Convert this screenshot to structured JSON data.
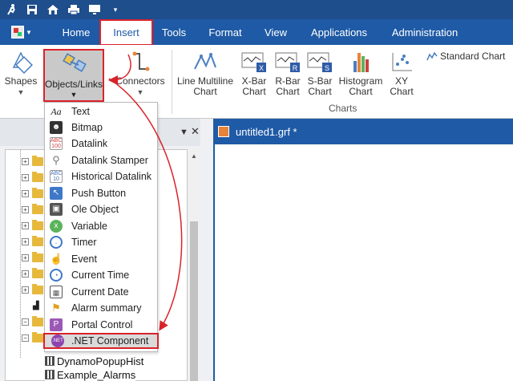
{
  "quick_access": {
    "icons": [
      "run-icon",
      "save-icon",
      "home-save-icon",
      "print-icon",
      "monitor-icon",
      "dropdown-icon"
    ]
  },
  "tabs": [
    {
      "label": "Home"
    },
    {
      "label": "Insert",
      "active": true
    },
    {
      "label": "Tools"
    },
    {
      "label": "Format"
    },
    {
      "label": "View"
    },
    {
      "label": "Applications"
    },
    {
      "label": "Administration"
    }
  ],
  "ribbon": {
    "shapes": "Shapes",
    "objects_links": "Objects/Links",
    "connectors": "Connectors",
    "line_multiline_chart": [
      "Line Multiline",
      "Chart"
    ],
    "xbar_chart": [
      "X-Bar",
      "Chart"
    ],
    "rbar_chart": [
      "R-Bar",
      "Chart"
    ],
    "sbar_chart": [
      "S-Bar",
      "Chart"
    ],
    "histogram_chart": [
      "Histogram",
      "Chart"
    ],
    "xy_chart": [
      "XY",
      "Chart"
    ],
    "standard_chart": "Standard Chart",
    "charts_group_label": "Charts"
  },
  "menu": {
    "items": [
      {
        "label": "Text",
        "icon": "text-aa-icon",
        "color": "#ffffff"
      },
      {
        "label": "Bitmap",
        "icon": "bitmap-icon",
        "color": "#333333"
      },
      {
        "label": "Datalink",
        "icon": "datalink-abc-icon",
        "color": "#d04040"
      },
      {
        "label": "Datalink Stamper",
        "icon": "datalink-stamper-icon",
        "color": "#777777"
      },
      {
        "label": "Historical Datalink",
        "icon": "historical-datalink-icon",
        "color": "#4a73b5"
      },
      {
        "label": "Push Button",
        "icon": "push-button-icon",
        "color": "#3f78c8"
      },
      {
        "label": "Ole Object",
        "icon": "ole-object-icon",
        "color": "#555555"
      },
      {
        "label": "Variable",
        "icon": "variable-icon",
        "color": "#5bb35b"
      },
      {
        "label": "Timer",
        "icon": "timer-icon",
        "color": "#3f78c8"
      },
      {
        "label": "Event",
        "icon": "event-icon",
        "color": "#3f78c8"
      },
      {
        "label": "Current Time",
        "icon": "current-time-icon",
        "color": "#3f78c8"
      },
      {
        "label": "Current Date",
        "icon": "current-date-icon",
        "color": "#555555"
      },
      {
        "label": "Alarm summary",
        "icon": "alarm-summary-icon",
        "color": "#e0a020"
      },
      {
        "label": "Portal Control",
        "icon": "portal-control-icon",
        "color": "#9b59b6"
      },
      {
        "label": ".NET Component",
        "icon": "net-component-icon",
        "color": "#8e44ad",
        "highlighted": true
      }
    ]
  },
  "document": {
    "title": "untitled1.grf *"
  },
  "tree": {
    "bottom_items": [
      {
        "label": "DynamoPopupHist"
      },
      {
        "label": "Example_Alarms"
      }
    ]
  },
  "colors": {
    "accent": "#1f5aa6",
    "highlight": "#d9232a"
  }
}
